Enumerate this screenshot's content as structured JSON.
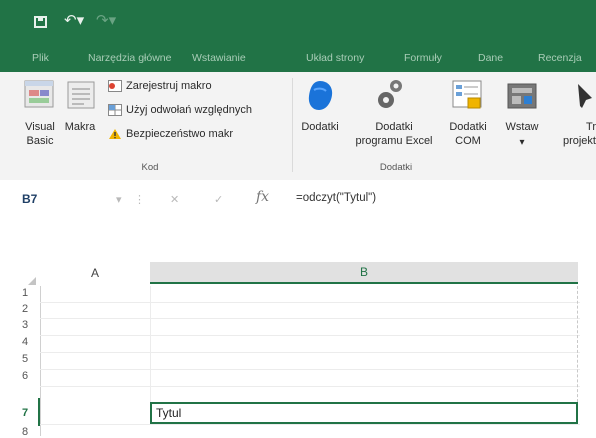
{
  "quick_access": {
    "save_icon": "save-icon",
    "undo_icon": "undo-icon",
    "redo_icon": "redo-icon"
  },
  "tabs": [
    "Plik",
    "Narzędzia główne",
    "Wstawianie",
    "Układ strony",
    "Formuły",
    "Dane",
    "Recenzja"
  ],
  "ribbon": {
    "visual_basic_label": "Visual\nBasic",
    "macros_label": "Makra",
    "record_macro": "Zarejestruj makro",
    "relative_refs": "Użyj odwołań względnych",
    "macro_security": "Bezpieczeństwo makr",
    "code_group": "Kod",
    "addins_label": "Dodatki",
    "excel_addins_label": "Dodatki\nprogramu Excel",
    "com_addins_label": "Dodatki\nCOM",
    "addins_group": "Dodatki",
    "insert_label": "Wstaw",
    "insert_arrow": "▾",
    "design_label": "Tr\nprojekt"
  },
  "formula_bar": {
    "name_box": "B7",
    "fx": "fx",
    "formula": "=odczyt(\"Tytul\")"
  },
  "grid": {
    "columns": [
      "A",
      "B"
    ],
    "rows": [
      "1",
      "2",
      "3",
      "4",
      "5",
      "6",
      "7",
      "8"
    ],
    "cell_b7": "Tytul"
  },
  "colors": {
    "accent": "#217346",
    "ribbon_bg": "#f3f3f3"
  }
}
